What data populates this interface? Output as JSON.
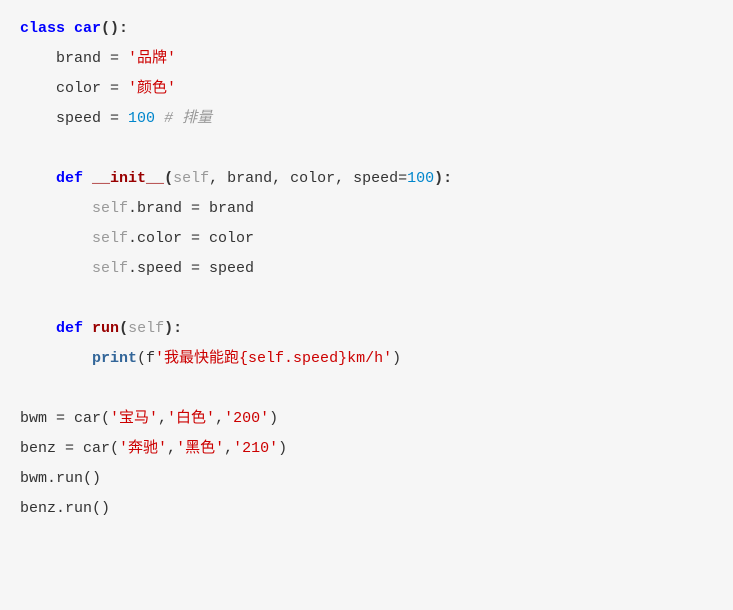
{
  "code": {
    "kw_class": "class",
    "class_name": "car",
    "attr_brand": "brand",
    "op_eq": " = ",
    "str_brand": "'品牌'",
    "attr_color": "color",
    "str_color": "'颜色'",
    "attr_speed": "speed",
    "num_100": "100",
    "cmt_speed": " # 排量",
    "kw_def1": "def",
    "fn_init": "__init__",
    "params_init": "(",
    "self": "self",
    "p_brand": ", brand, color, speed=",
    "p_close": "):",
    "init_l1a": ".brand = brand",
    "init_l2a": ".color = color",
    "init_l3a": ".speed = speed",
    "kw_def2": "def",
    "fn_run": "run",
    "params_run": "(",
    "p_run_close": "):",
    "print": "print",
    "print_open": "(f",
    "fstr1": "'我最快能跑{self.speed}km/h'",
    "print_close": ")",
    "v_bwm": "bwm = car(",
    "s_bmw1": "'宝马'",
    "comma": ",",
    "s_bmw2": "'白色'",
    "s_bmw3": "'200'",
    "close_paren": ")",
    "v_benz": "benz = car(",
    "s_bz1": "'奔驰'",
    "s_bz2": "'黑色'",
    "s_bz3": "'210'",
    "call_bwm": "bwm.run()",
    "call_benz": "benz.run()"
  }
}
